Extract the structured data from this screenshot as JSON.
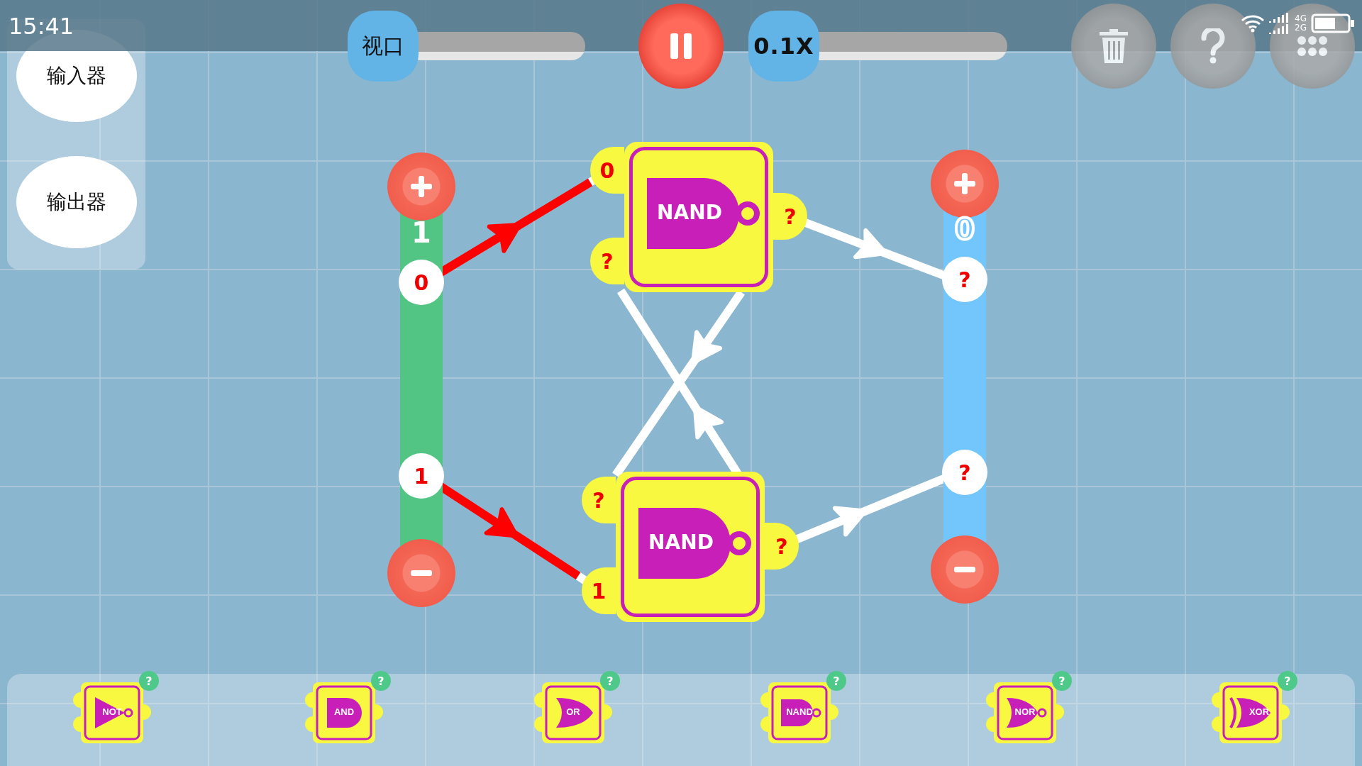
{
  "status_bar": {
    "time": "15:41",
    "network_labels": [
      "4G",
      "2G"
    ]
  },
  "side_panel": {
    "buttons": [
      "输入器",
      "输出器"
    ]
  },
  "toolbar": {
    "viewport_slider": {
      "label": "视口",
      "level": 0
    },
    "pause_button": {
      "paused": false
    },
    "speed_slider": {
      "label": "0.1X",
      "level": 0
    }
  },
  "buses": [
    {
      "kind": "input",
      "value": "1",
      "pins": [
        "0",
        "1"
      ]
    },
    {
      "kind": "output",
      "value": "0",
      "pins": [
        "?",
        "?"
      ]
    }
  ],
  "gates": [
    {
      "label": "NAND",
      "inputs": [
        "0",
        "?"
      ],
      "output": "?"
    },
    {
      "label": "NAND",
      "inputs": [
        "?",
        "1"
      ],
      "output": "?"
    }
  ],
  "wires": [
    {
      "active": true
    },
    {
      "active": true
    },
    {
      "active": false
    },
    {
      "active": false
    },
    {
      "active": false
    },
    {
      "active": false
    }
  ],
  "palette": [
    {
      "kind": "not",
      "label": "NOT",
      "help": "?"
    },
    {
      "kind": "and",
      "label": "AND",
      "help": "?"
    },
    {
      "kind": "or",
      "label": "OR",
      "help": "?"
    },
    {
      "kind": "nand",
      "label": "NAND",
      "help": "?"
    },
    {
      "kind": "nor",
      "label": "NOR",
      "help": "?"
    },
    {
      "kind": "xor",
      "label": "XOR",
      "help": "?"
    }
  ]
}
